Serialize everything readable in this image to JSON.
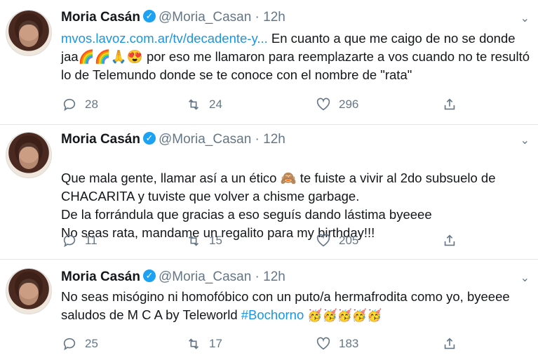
{
  "tweets": [
    {
      "name": "Moria Casán",
      "handle": "@Moria_Casan · 12h",
      "link": "mvos.lavoz.com.ar/tv/decadente-y...",
      "text": " En cuanto a que me caigo de no se donde jaa🌈🌈🙏😍 por eso me llamaron para reemplazarte a vos cuando no te resultó lo de Telemundo donde se te conoce con el nombre de \"rata\"",
      "replies": "28",
      "retweets": "24",
      "likes": "296"
    },
    {
      "name": "Moria Casán",
      "handle": "@Moria_Casan · 12h",
      "text": "Que mala gente, llamar así a un ético 🙈 te fuiste a vivir al 2do subsuelo de CHACARITA y tuviste que volver a chisme garbage.\nDe la forrándula que gracias a eso seguís dando lástima byeeee\nNo seas rata, mandame un regalito para my birthday!!!",
      "replies": "11",
      "retweets": "15",
      "likes": "205"
    },
    {
      "name": "Moria Casán",
      "handle": "@Moria_Casan · 12h",
      "text": "No seas misógino ni homofóbico con un puto/a hermafrodita como yo, byeeee saludos de M C A by Teleworld ",
      "hashtag": "#Bochorno",
      "emojis": "🥳🥳🥳🥳🥳",
      "replies": "25",
      "retweets": "17",
      "likes": "183"
    }
  ],
  "icons": {
    "verified": "check",
    "reply": "reply-icon",
    "retweet": "retweet-icon",
    "like": "heart-icon",
    "share": "share-icon",
    "more": "chevron-down-icon"
  },
  "colors": {
    "link": "#1b95e0",
    "verified": "#1da1f2",
    "muted": "#657786"
  }
}
